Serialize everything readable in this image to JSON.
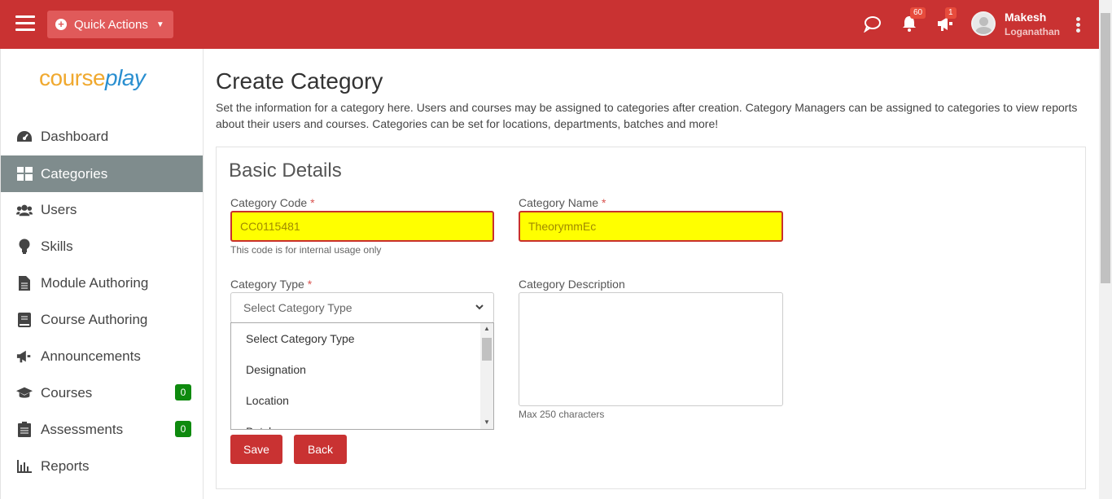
{
  "header": {
    "quick_actions_label": "Quick Actions",
    "notifications_count": "60",
    "announcements_count": "1",
    "user_first_name": "Makesh",
    "user_last_name": "Loganathan",
    "brand_color": "#c93232"
  },
  "sidebar": {
    "logo_part1": "course",
    "logo_part2": "play",
    "items": [
      {
        "label": "Dashboard",
        "icon": "dashboard-icon"
      },
      {
        "label": "Categories",
        "icon": "grid-icon",
        "active": true
      },
      {
        "label": "Users",
        "icon": "users-icon"
      },
      {
        "label": "Skills",
        "icon": "lightbulb-icon"
      },
      {
        "label": "Module Authoring",
        "icon": "file-icon"
      },
      {
        "label": "Course Authoring",
        "icon": "book-icon"
      },
      {
        "label": "Announcements",
        "icon": "megaphone-icon"
      },
      {
        "label": "Courses",
        "icon": "graduation-cap-icon",
        "count": "0"
      },
      {
        "label": "Assessments",
        "icon": "clipboard-icon",
        "count": "0"
      },
      {
        "label": "Reports",
        "icon": "bar-chart-icon"
      }
    ]
  },
  "main": {
    "title": "Create Category",
    "description": "Set the information for a category here. Users and courses may be assigned to categories after creation. Category Managers can be assigned to categories to view reports about their users and courses. Categories can be set for locations, departments, batches and more!",
    "section_title": "Basic Details",
    "category_code_label": "Category Code",
    "category_code_value": "CC0115481",
    "category_code_hint": "This code is for internal usage only",
    "category_name_label": "Category Name",
    "category_name_value": "TheorymmEc",
    "category_type_label": "Category Type",
    "category_type_selected": "Select Category Type",
    "category_type_options": [
      "Select Category Type",
      "Designation",
      "Location",
      "Batch"
    ],
    "category_description_label": "Category Description",
    "category_description_hint": "Max 250 characters",
    "required_mark": "*",
    "save_label": "Save",
    "back_label": "Back"
  }
}
